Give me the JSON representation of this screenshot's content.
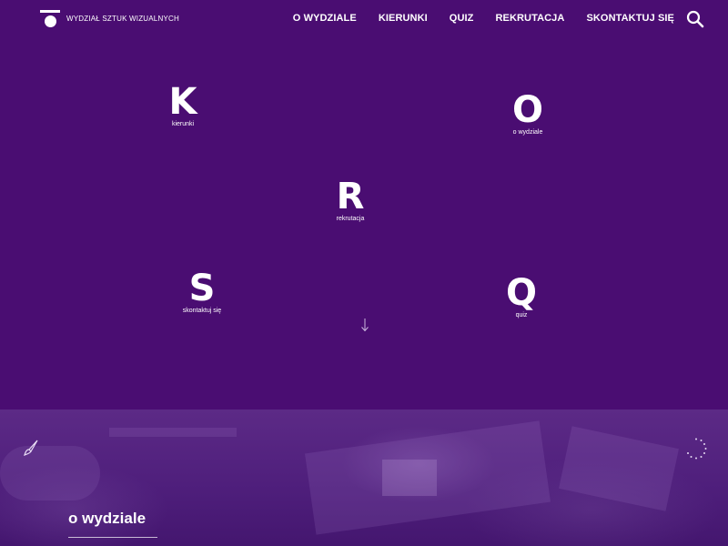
{
  "header": {
    "brand": "WYDZIAŁ SZTUK WIZUALNYCH",
    "nav": [
      "O WYDZIALE",
      "KIERUNKI",
      "QUIZ",
      "REKRUTACJA",
      "SKONTAKTUJ SIĘ"
    ],
    "search_icon": "search-icon"
  },
  "tiles": [
    {
      "letter": "K",
      "label": "kierunki"
    },
    {
      "letter": "O",
      "label": "o wydziale"
    },
    {
      "letter": "R",
      "label": "rekrutacja"
    },
    {
      "letter": "S",
      "label": "skontaktuj się"
    },
    {
      "letter": "Q",
      "label": "quiz"
    }
  ],
  "scroll_icon": "arrow-down-icon",
  "section": {
    "title": "o wydziale",
    "left_icon": "brush-icon",
    "right_icon": "dots-spinner-icon"
  },
  "colors": {
    "background": "#4a0d72",
    "text": "#ffffff"
  }
}
